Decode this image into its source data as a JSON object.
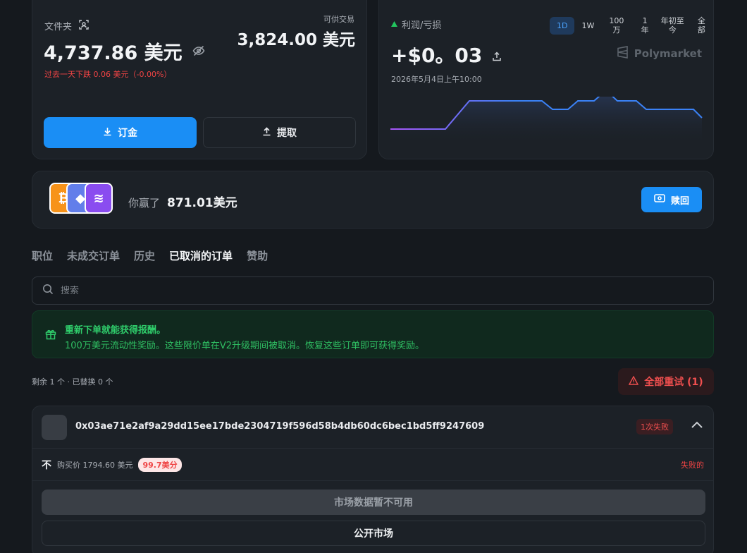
{
  "portfolio": {
    "label": "文件夹",
    "value": "4,737.86 美元",
    "change": "过去一天下跌 0.06 美元（-0.00%）",
    "available_label": "可供交易",
    "available_value": "3,824.00 美元",
    "deposit_label": "订金",
    "withdraw_label": "提取"
  },
  "pnl": {
    "label": "利润/亏损",
    "value": "+$0。03",
    "date": "2026年5月4日上午10:00",
    "brand": "Polymarket",
    "ranges": [
      "1D",
      "1W",
      "100万",
      "1年",
      "年初至今",
      "全部"
    ],
    "active_range": "1D",
    "positive_color": "#22c55e",
    "chart_colors": {
      "start": "#7c3aed",
      "end": "#3b82f6"
    }
  },
  "rewards": {
    "text": "你赢了",
    "amount": "871.01美元",
    "redeem_label": "赎回"
  },
  "tabs": [
    "职位",
    "未成交订单",
    "历史",
    "已取消的订单",
    "赞助"
  ],
  "active_tab": "已取消的订单",
  "search": {
    "placeholder": "搜索"
  },
  "banner": {
    "title": "重新下单就能获得报酬。",
    "body": "100万美元流动性奖励。这些限价单在V2升级期间被取消。恢复这些订单即可获得奖励。"
  },
  "summary": {
    "remaining": "剩余 1 个 · 已替换 0 个",
    "retry_all_label": "全部重试 (1)"
  },
  "order": {
    "hash": "0x03ae71e2af9a29dd15ee17bde2304719f596d58b4db60dc6bec1bd5ff9247609",
    "fail_badge": "1次失败",
    "side": "不",
    "price": "购买价 1794.60 美元",
    "cents": "99.7美分",
    "status": "失败的",
    "market_unavailable": "市场数据暂不可用",
    "open_market_label": "公开市场"
  }
}
